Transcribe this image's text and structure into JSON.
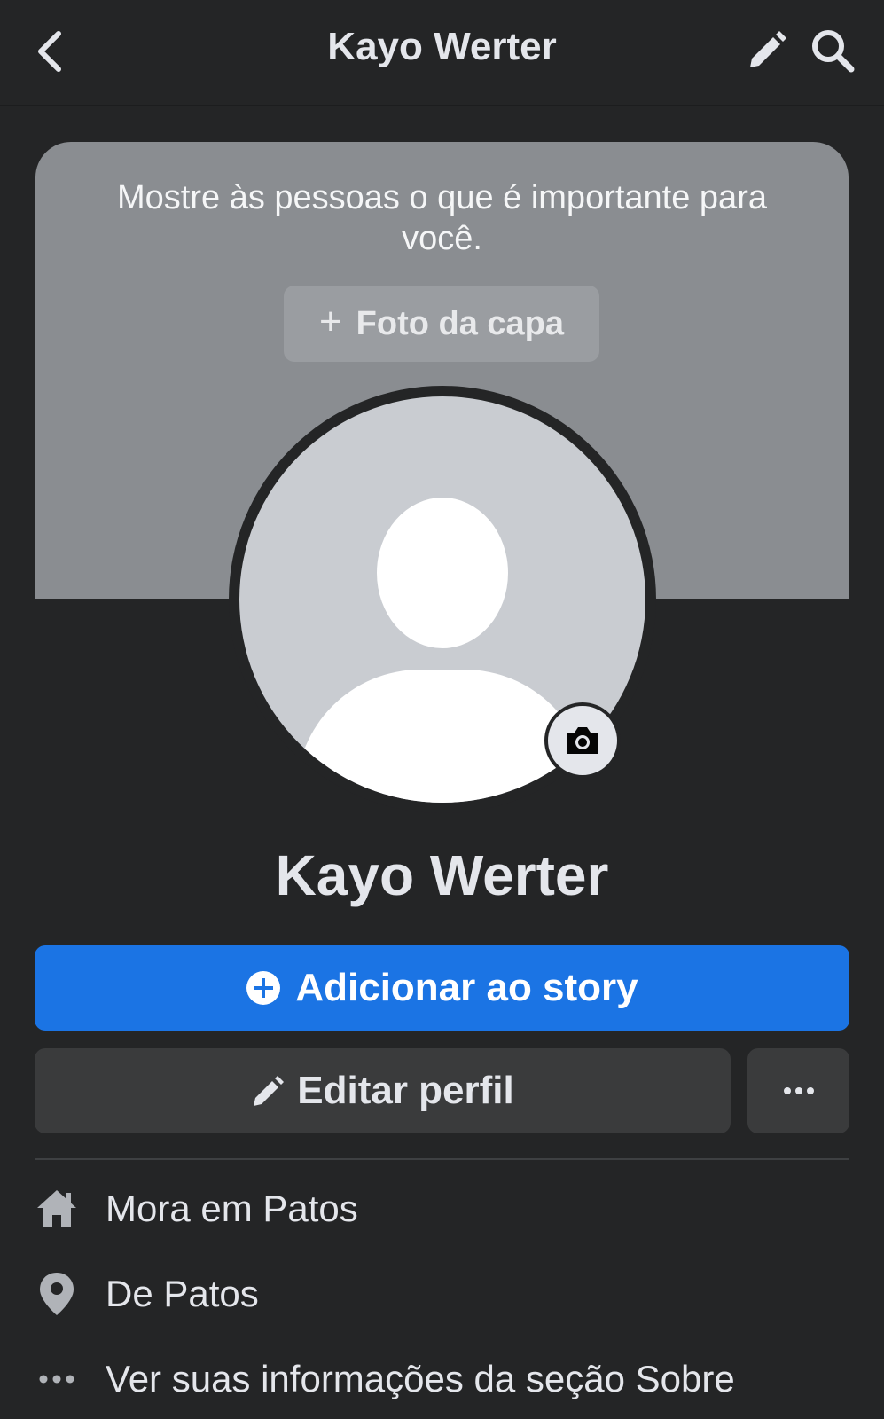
{
  "header": {
    "title": "Kayo Werter",
    "icons": [
      "chevron-left-icon",
      "pencil-icon",
      "search-icon"
    ]
  },
  "cover": {
    "message": "Mostre às pessoas o que é importante para você.",
    "button_label": "Foto da capa",
    "button_icon": "plus-icon"
  },
  "profile": {
    "name": "Kayo Werter",
    "avatar_icon": "default-avatar-icon",
    "camera_icon": "camera-icon"
  },
  "actions": {
    "story_label": "Adicionar ao story",
    "story_icon": "plus-circle-icon",
    "edit_label": "Editar perfil",
    "edit_icon": "pencil-icon",
    "more_icon": "ellipsis-icon"
  },
  "info": [
    {
      "icon": "home-icon",
      "text": "Mora em Patos"
    },
    {
      "icon": "location-pin-icon",
      "text": "De Patos"
    },
    {
      "icon": "ellipsis-icon",
      "text": "Ver suas informações da seção Sobre"
    }
  ],
  "colors": {
    "background": "#242526",
    "primary": "#1b74e4",
    "button_secondary": "#3a3b3c",
    "cover": "#8a8d91"
  }
}
